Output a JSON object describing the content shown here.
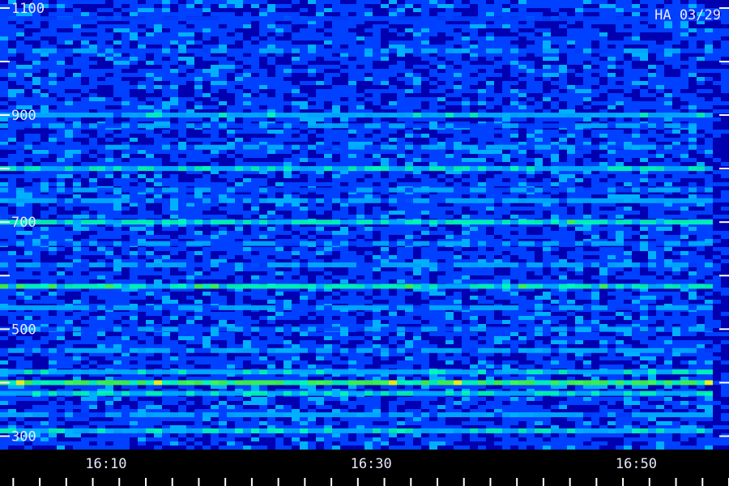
{
  "chart_data": {
    "type": "heatmap",
    "title": "",
    "corner_label": "HA 03/29",
    "xlabel": "",
    "ylabel": "",
    "x_tick_labels": [
      "16:10",
      "16:30",
      "16:50"
    ],
    "x_tick_values_min": [
      10,
      30,
      50
    ],
    "x_range_min": [
      2,
      57
    ],
    "data_end_min": 55.5,
    "y_tick_labels": [
      "1100",
      "900",
      "700",
      "500",
      "300"
    ],
    "y_tick_values": [
      1100,
      900,
      700,
      500,
      300
    ],
    "y_range": [
      275,
      1115
    ],
    "colormap": [
      "#000040",
      "#0000b0",
      "#0040ff",
      "#00b0ff",
      "#00ffb0",
      "#40ff40",
      "#ffff00"
    ],
    "background": "#000000",
    "bands": [
      {
        "freq": 1080,
        "intensity": 0.35
      },
      {
        "freq": 1020,
        "intensity": 0.45
      },
      {
        "freq": 900,
        "intensity": 0.55
      },
      {
        "freq": 880,
        "intensity": 0.45
      },
      {
        "freq": 840,
        "intensity": 0.45
      },
      {
        "freq": 800,
        "intensity": 0.6
      },
      {
        "freq": 760,
        "intensity": 0.45
      },
      {
        "freq": 740,
        "intensity": 0.5
      },
      {
        "freq": 700,
        "intensity": 0.7
      },
      {
        "freq": 660,
        "intensity": 0.45
      },
      {
        "freq": 620,
        "intensity": 0.5
      },
      {
        "freq": 580,
        "intensity": 0.7
      },
      {
        "freq": 540,
        "intensity": 0.5
      },
      {
        "freq": 500,
        "intensity": 0.45
      },
      {
        "freq": 460,
        "intensity": 0.5
      },
      {
        "freq": 420,
        "intensity": 0.55
      },
      {
        "freq": 400,
        "intensity": 0.85
      },
      {
        "freq": 380,
        "intensity": 0.6
      },
      {
        "freq": 340,
        "intensity": 0.5
      },
      {
        "freq": 310,
        "intensity": 0.6
      }
    ]
  }
}
